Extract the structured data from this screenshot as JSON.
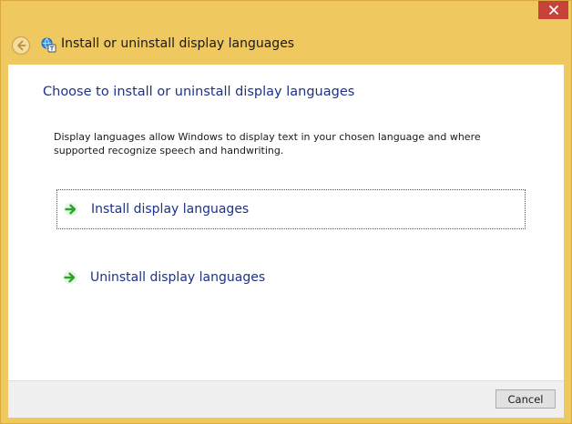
{
  "window": {
    "title": "Install or uninstall display languages"
  },
  "content": {
    "heading": "Choose to install or uninstall display languages",
    "description": "Display languages allow Windows to display text in your chosen language and where supported recognize speech and handwriting."
  },
  "commands": [
    {
      "label": "Install display languages",
      "icon": "green-arrow-icon",
      "focused": true
    },
    {
      "label": "Uninstall display languages",
      "icon": "green-arrow-icon",
      "focused": false
    }
  ],
  "footer": {
    "cancel_label": "Cancel"
  },
  "colors": {
    "frame": "#f0c860",
    "close_button": "#c7433a",
    "link_text": "#1e3287",
    "arrow": "#2aa52a"
  }
}
